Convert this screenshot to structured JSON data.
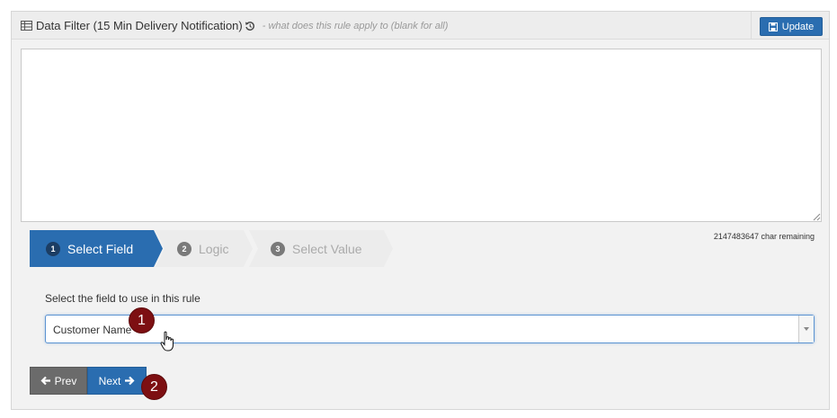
{
  "header": {
    "title": "Data Filter (15 Min Delivery Notification)",
    "hint": "- what does this rule apply to (blank for all)",
    "update_label": "Update"
  },
  "rule_text": {
    "value": "",
    "char_remaining": "2147483647 char remaining"
  },
  "wizard": {
    "steps": [
      {
        "number": "1",
        "label": "Select Field",
        "active": true
      },
      {
        "number": "2",
        "label": "Logic",
        "active": false
      },
      {
        "number": "3",
        "label": "Select Value",
        "active": false
      }
    ]
  },
  "field_select": {
    "prompt": "Select the field to use in this rule",
    "selected": "Customer Name"
  },
  "nav": {
    "prev_label": "Prev",
    "next_label": "Next"
  },
  "callouts": [
    "1",
    "2"
  ],
  "colors": {
    "primary": "#2a6db0",
    "callout": "#7d0f12",
    "prev": "#6b6b6b"
  },
  "icons": [
    "table-icon",
    "history-icon",
    "save-icon",
    "arrow-left-icon",
    "arrow-right-icon",
    "hand-pointer-icon"
  ]
}
